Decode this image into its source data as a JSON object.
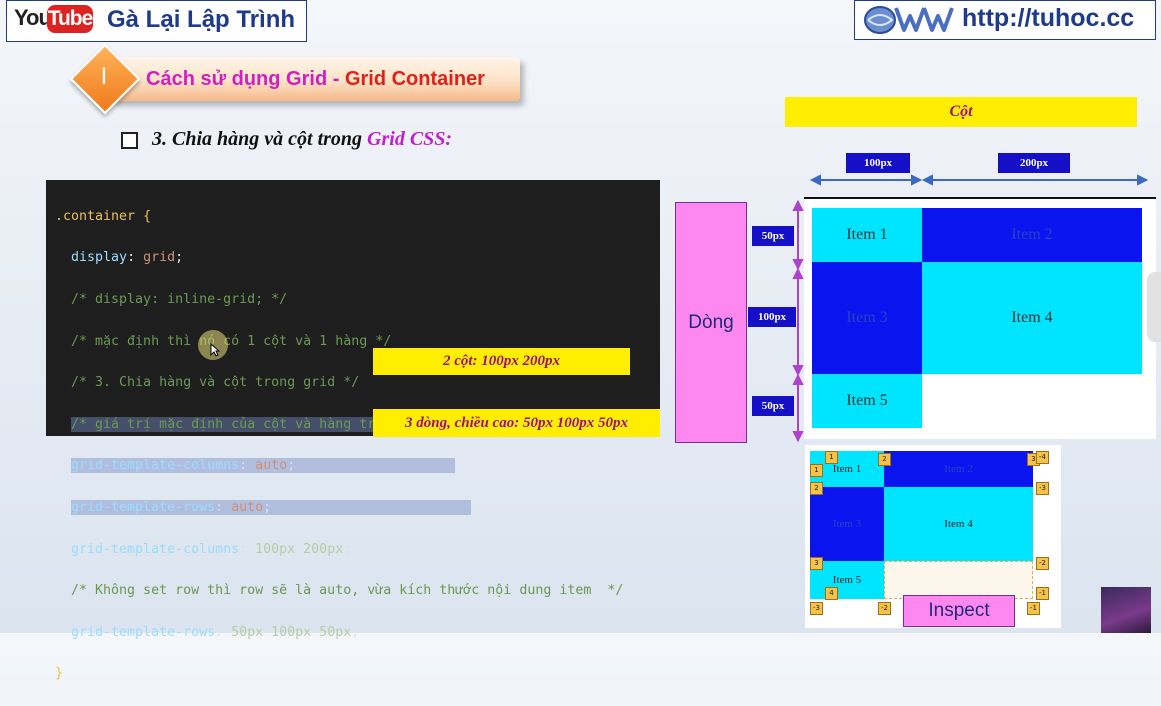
{
  "header": {
    "logo_you": "You",
    "logo_tube": "Tube",
    "channel_name": "Gà Lại Lập Trình",
    "site_url": "http://tuhoc.cc"
  },
  "section": {
    "number": "I",
    "title_part1": "Cách sử dụng Grid - ",
    "title_part2": "Grid Container"
  },
  "subheading": {
    "text": "3. Chia hàng và cột trong ",
    "highlight": "Grid CSS:"
  },
  "code": {
    "line1_selector": ".container",
    "line1_brace": " {",
    "line2_prop": "  display",
    "line2_val": "grid",
    "line3": "  /* display: inline-grid; */",
    "line4": "  /* mặc định thì nó có 1 cột và 1 hàng */",
    "line5": "  /* 3. Chia hàng và cột trong grid */",
    "line6": "/* giá trị mặc định của cột và hàng trong grid */",
    "line7_prop": "grid-template-columns",
    "line7_val": "auto",
    "line8_prop": "grid-template-rows",
    "line8_val": "auto",
    "line9_prop": "  grid-template-columns",
    "line9_val": "100px 200px",
    "line10": "  /* Không set row thì row sẽ là auto, vừa kích thước nội dung item  */",
    "line11_prop": "  grid-template-rows",
    "line11_val": "50px 100px 50px",
    "line12": "}"
  },
  "callouts": {
    "columns": "2 cột: 100px 200px",
    "rows": "3 dòng, chiều cao: 50px  100px 50px"
  },
  "diagram": {
    "cot_label": "Cột",
    "dong_label": "Dòng",
    "col_sizes": [
      "100px",
      "200px"
    ],
    "row_sizes": [
      "50px",
      "100px",
      "50px"
    ],
    "items": [
      "Item 1",
      "Item 2",
      "Item 3",
      "Item 4",
      "Item 5"
    ]
  },
  "inspect": {
    "button_label": "Inspect",
    "items": [
      "Item 1",
      "Item 2",
      "Item 3",
      "Item 4",
      "Item 5"
    ],
    "line_numbers": [
      "1",
      "2",
      "3",
      "-4",
      "1",
      "-3",
      "2",
      "-2",
      "3",
      "-1",
      "4",
      "-3",
      "-2",
      "-1"
    ]
  },
  "colors": {
    "cyan": "#00e5ff",
    "blue": "#0a14ee",
    "yellow": "#ffee00",
    "magenta": "#c020d0",
    "pink_box": "#ff88f0",
    "tag_blue": "#1510c8"
  }
}
